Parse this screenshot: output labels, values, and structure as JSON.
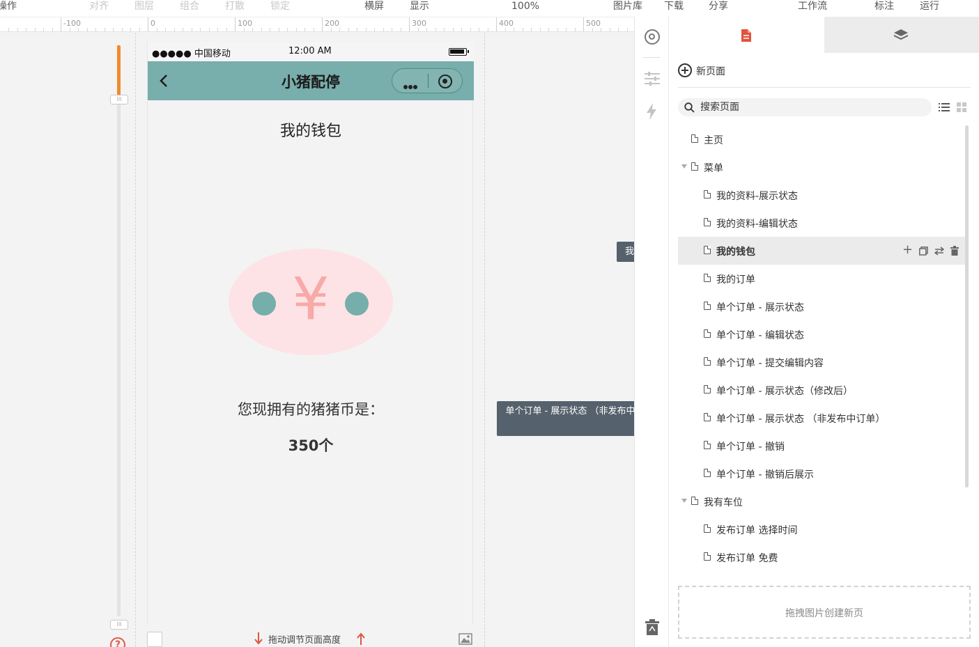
{
  "toolbar": {
    "operate": "操作",
    "align": "对齐",
    "layer": "图层",
    "group": "组合",
    "ungroup": "打散",
    "lock": "锁定",
    "landscape": "横屏",
    "display": "显示",
    "zoom": "100%",
    "image_library": "图片库",
    "download": "下载",
    "share": "分享",
    "workflow": "工作流",
    "annotate": "标注",
    "run": "运行"
  },
  "ruler": {
    "labels": [
      "-100",
      "0",
      "100",
      "200",
      "300",
      "400",
      "500"
    ]
  },
  "phone": {
    "carrier": "●●●●● 中国移动",
    "time": "12:00 AM",
    "nav_title": "小猪配停",
    "page_heading": "我的钱包",
    "yen_symbol": "¥",
    "coins_text": "您现拥有的猪猪币是：",
    "coins_count": "350个"
  },
  "canvas": {
    "drag_hint": "拖动调节页面高度"
  },
  "tooltips": {
    "current_page": "我的钱包",
    "hover_page": "单个订单 - 展示状态 （非发布中订单）"
  },
  "panel": {
    "new_page": "新页面",
    "search_placeholder": "搜索页面",
    "pages": [
      {
        "label": "主页",
        "level": 0,
        "folder": false
      },
      {
        "label": "菜单",
        "level": 0,
        "folder": true
      },
      {
        "label": "我的资料-展示状态",
        "level": 1,
        "folder": false
      },
      {
        "label": "我的资料-编辑状态",
        "level": 1,
        "folder": false
      },
      {
        "label": "我的钱包",
        "level": 1,
        "folder": false,
        "selected": true
      },
      {
        "label": "我的订单",
        "level": 1,
        "folder": false
      },
      {
        "label": "单个订单 - 展示状态",
        "level": 1,
        "folder": false
      },
      {
        "label": "单个订单 - 编辑状态",
        "level": 1,
        "folder": false
      },
      {
        "label": "单个订单 - 提交编辑内容",
        "level": 1,
        "folder": false
      },
      {
        "label": "单个订单 - 展示状态（修改后）",
        "level": 1,
        "folder": false
      },
      {
        "label": "单个订单 - 展示状态 （非发布中订单）",
        "level": 1,
        "folder": false
      },
      {
        "label": "单个订单 - 撤销",
        "level": 1,
        "folder": false
      },
      {
        "label": "单个订单 - 撤销后展示",
        "level": 1,
        "folder": false
      },
      {
        "label": "我有车位",
        "level": 0,
        "folder": true
      },
      {
        "label": "发布订单 选择时间",
        "level": 1,
        "folder": false
      },
      {
        "label": "发布订单 免费",
        "level": 1,
        "folder": false
      }
    ],
    "dropzone": "拖拽图片创建新页"
  },
  "colors": {
    "navbar": "#78aeab",
    "accent_orange": "#f08a2c",
    "coin_pink": "#fde3e5",
    "yen_pink": "#f8a9a8",
    "eye_teal": "#76aeab",
    "doc_red": "#e0533f",
    "tooltip_bg": "#55616c"
  }
}
